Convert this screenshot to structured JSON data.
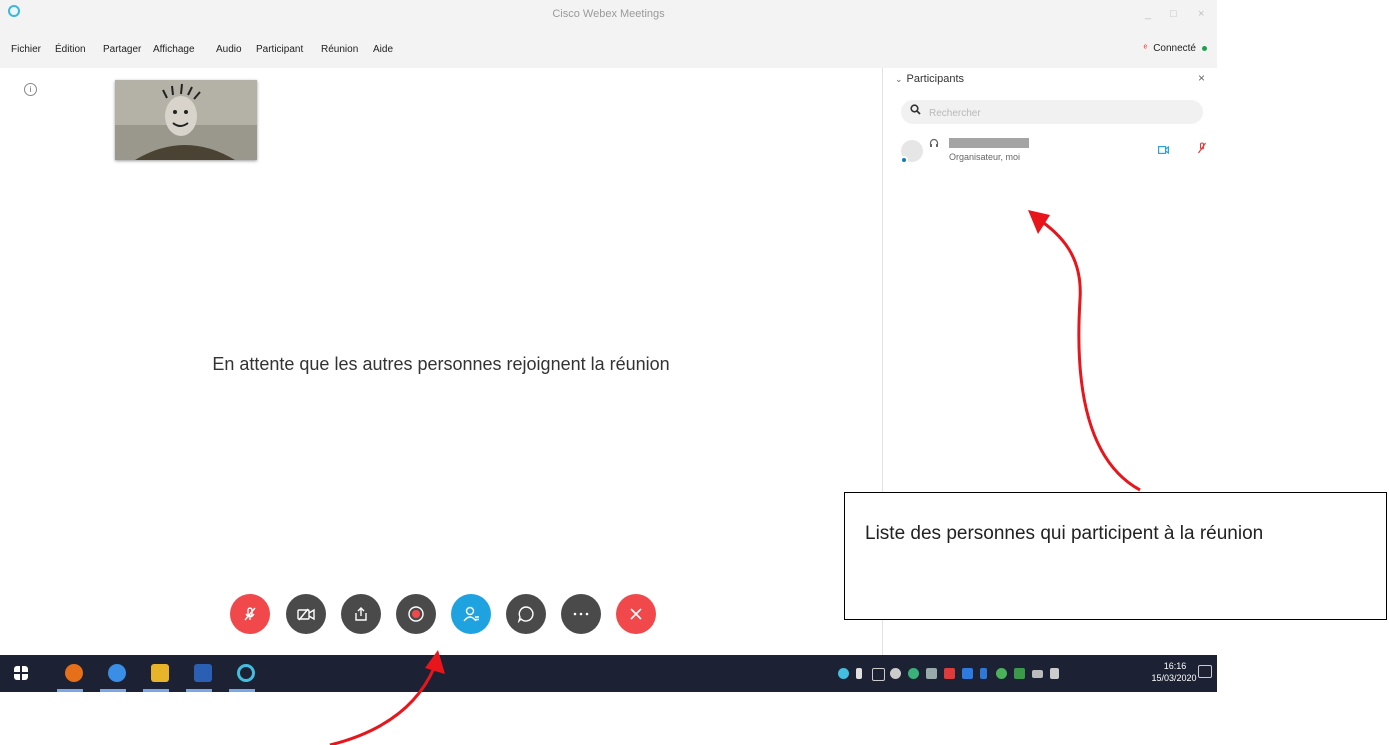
{
  "window": {
    "title": "Cisco Webex Meetings",
    "controls": {
      "minimize": "_",
      "maximize": "□",
      "close": "×"
    }
  },
  "menu": {
    "items": [
      "Fichier",
      "Édition",
      "Partager",
      "Affichage",
      "Audio",
      "Participant",
      "Réunion",
      "Aide"
    ],
    "status": "Connecté",
    "status_color": "#19a34a"
  },
  "stage": {
    "waiting_text": "En attente que les autres personnes rejoignent la réunion"
  },
  "controls": [
    {
      "name": "mute-button",
      "icon": "mic-off-icon",
      "color": "#f0484b"
    },
    {
      "name": "video-button",
      "icon": "video-off-icon",
      "color": "#4a4a4a"
    },
    {
      "name": "share-button",
      "icon": "share-icon",
      "color": "#4a4a4a"
    },
    {
      "name": "record-button",
      "icon": "record-icon",
      "color": "#4a4a4a"
    },
    {
      "name": "participants-button",
      "icon": "participants-icon",
      "color": "#1fa3e0"
    },
    {
      "name": "chat-button",
      "icon": "chat-icon",
      "color": "#4a4a4a"
    },
    {
      "name": "more-button",
      "icon": "more-icon",
      "color": "#4a4a4a"
    },
    {
      "name": "leave-button",
      "icon": "close-icon",
      "color": "#f0484b"
    }
  ],
  "panel": {
    "title": "Participants",
    "search_placeholder": "Rechercher",
    "participants": [
      {
        "role": "Organisateur, moi"
      }
    ]
  },
  "taskbar": {
    "time": "16:16",
    "date": "15/03/2020"
  },
  "annotation": {
    "callout_text": "Liste des personnes qui participent à la réunion",
    "arrow_color": "#e8151b"
  }
}
